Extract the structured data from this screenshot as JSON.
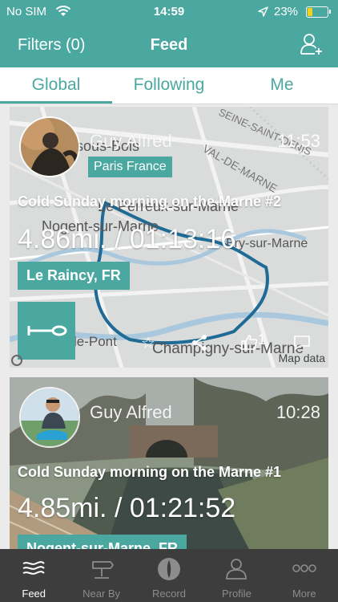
{
  "status_bar": {
    "carrier": "No SIM",
    "time": "14:59",
    "battery_percent": "23%",
    "battery_level": 0.23
  },
  "header": {
    "filters_label": "Filters (0)",
    "title": "Feed",
    "add_user_icon": "add-user-icon"
  },
  "tabs": [
    {
      "label": "Global",
      "selected": true
    },
    {
      "label": "Following",
      "selected": false
    },
    {
      "label": "Me",
      "selected": false
    }
  ],
  "feed": [
    {
      "user": "Guy Alfred",
      "time": "11:53",
      "user_location": "Paris France",
      "title": "Cold Sunday morning on the Marne #2",
      "stats": "4.86mi. / 01:13:16",
      "route_location": "Le Raincy, FR",
      "map_labels": [
        "ny-sous-Bois",
        "VAL-DE-MARNE",
        "SEINE-SAINT-DENIS",
        "Le Perreux-sur-Marne",
        "Nogent-sur-Marne",
        "Bry-sur-Marne",
        "le-Pont",
        "Champigny-sur-Marne"
      ],
      "map_attribution": "Map data",
      "likes": "1"
    },
    {
      "user": "Guy Alfred",
      "time": "10:28",
      "title": "Cold Sunday morning on the Marne #1",
      "stats": "4.85mi. / 01:21:52",
      "route_location": "Nogent-sur-Marne, FR"
    }
  ],
  "tab_bar": [
    {
      "label": "Feed",
      "icon": "feed-icon",
      "active": true
    },
    {
      "label": "Near By",
      "icon": "signpost-icon",
      "active": false
    },
    {
      "label": "Record",
      "icon": "record-icon",
      "active": false
    },
    {
      "label": "Profile",
      "icon": "profile-icon",
      "active": false
    },
    {
      "label": "More",
      "icon": "more-icon",
      "active": false
    }
  ],
  "colors": {
    "accent": "#4aa8a0",
    "tab_bar": "#3d3d3d",
    "battery": "#f2d21b"
  }
}
